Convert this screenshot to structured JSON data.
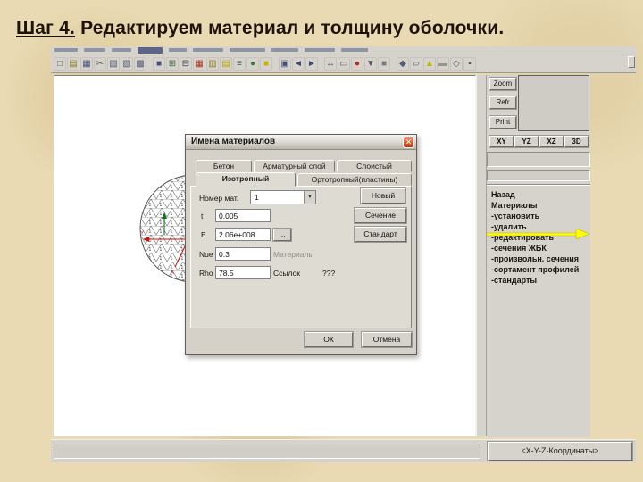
{
  "slide": {
    "title_prefix": "Шаг 4.",
    "title_rest": " Редактируем материал и толщину оболочки."
  },
  "toolbar": {
    "icons": [
      {
        "g": "□",
        "c": "#5a5a66"
      },
      {
        "g": "▤",
        "c": "#8a7a22"
      },
      {
        "g": "▦",
        "c": "#44507a"
      },
      {
        "g": "✂",
        "c": "#555550"
      },
      {
        "g": "▧",
        "c": "#555a77"
      },
      {
        "g": "▨",
        "c": "#555a77"
      },
      {
        "g": "▩",
        "c": "#555a77"
      },
      {
        "g": "■",
        "c": "#44507a",
        "gap": true
      },
      {
        "g": "⊞",
        "c": "#3f6a3f"
      },
      {
        "g": "⊟",
        "c": "#44444a"
      },
      {
        "g": "▦",
        "c": "#a03020"
      },
      {
        "g": "▥",
        "c": "#8a7a22"
      },
      {
        "g": "▤",
        "c": "#b8a800"
      },
      {
        "g": "≡",
        "c": "#54545e"
      },
      {
        "g": "●",
        "c": "#3f7a3f"
      },
      {
        "g": "■",
        "c": "#c2b400"
      },
      {
        "g": "▣",
        "c": "#44507a",
        "gap": true
      },
      {
        "g": "◄",
        "c": "#3a4a7a"
      },
      {
        "g": "►",
        "c": "#3a4a7a"
      },
      {
        "g": "↔",
        "c": "#3a4a7a",
        "gap": true
      },
      {
        "g": "▭",
        "c": "#55555a"
      },
      {
        "g": "●",
        "c": "#c02818"
      },
      {
        "g": "▼",
        "c": "#55555a"
      },
      {
        "g": "■",
        "c": "#7a7a80"
      },
      {
        "g": "◆",
        "c": "#555a77",
        "gap": true
      },
      {
        "g": "▱",
        "c": "#55555a"
      },
      {
        "g": "▲",
        "c": "#c2b400"
      },
      {
        "g": "▬",
        "c": "#98948c"
      },
      {
        "g": "◇",
        "c": "#555a77"
      },
      {
        "g": "▪",
        "c": "#55555a"
      }
    ]
  },
  "right_panel": {
    "tool_buttons": [
      "Zoom",
      "Refr",
      "Print"
    ],
    "view_buttons": [
      "XY",
      "YZ",
      "XZ",
      "3D"
    ],
    "nav_items": [
      "Назад",
      "Материалы",
      "-установить",
      "-удалить",
      "-редактировать",
      "-сечения ЖБК",
      "-произвольн. сечения",
      "-сортамент профилей",
      "-стандарты"
    ],
    "highlighted_item": "-редактировать",
    "highlight_color": "#ffff00"
  },
  "status_bar": {
    "coords_label": "<X-Y-Z-Координаты>"
  },
  "dialog": {
    "title": "Имена материалов",
    "close_glyph": "✕",
    "tabs_row1": [
      "Бетон",
      "Арматурный слой",
      "Слоистый"
    ],
    "tabs_row2": [
      "Изотропный",
      "Ортотропный(пластины)"
    ],
    "active_tab": "Изотропный",
    "number_label": "Номер мат.",
    "number_value": "1",
    "dropdown_glyph": "▼",
    "rows": [
      {
        "label": "t",
        "value": "0.005"
      },
      {
        "label": "E",
        "value": "2.06e+008"
      },
      {
        "label": "Nue",
        "value": "0.3"
      },
      {
        "label": "Rho",
        "value": "78.5"
      }
    ],
    "buttons": {
      "new": "Новый",
      "section": "Сечение",
      "standard": "Стандарт",
      "ellipsis": "...",
      "ok": "ОК",
      "cancel": "Отмена"
    },
    "labels": {
      "materials_disabled": "Материалы",
      "links_label": "Ссылок",
      "links_value": "???"
    }
  }
}
